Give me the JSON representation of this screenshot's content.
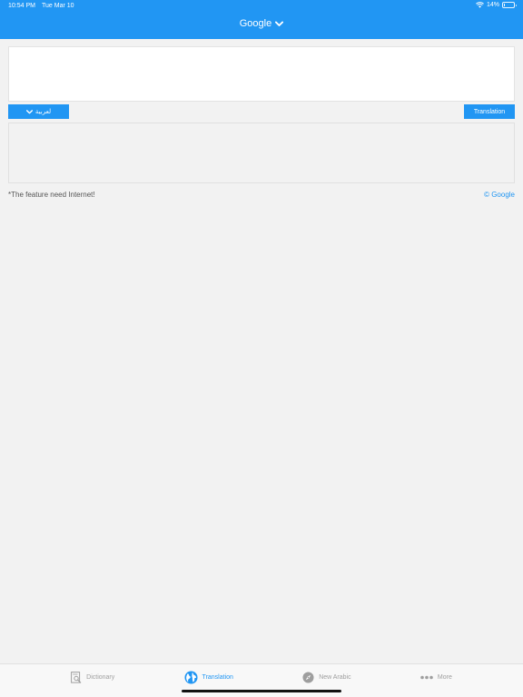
{
  "status_bar": {
    "time": "10:54 PM",
    "date": "Tue Mar 10",
    "battery": "14%",
    "battery_level": 0.14
  },
  "header": {
    "title": "Google"
  },
  "input": {
    "text": ""
  },
  "controls": {
    "language_label": "لعربية",
    "translate_label": "Translation"
  },
  "output": {
    "text": ""
  },
  "notice": "*The feature need Internet!",
  "credit": "© Google",
  "tabs": [
    {
      "label": "Dictionary",
      "icon": "dictionary-icon",
      "active": false
    },
    {
      "label": "Translation",
      "icon": "globe-icon",
      "active": true
    },
    {
      "label": "New Arabic",
      "icon": "compass-icon",
      "active": false
    },
    {
      "label": "More",
      "icon": "more-icon",
      "active": false
    }
  ],
  "colors": {
    "accent": "#2196f3",
    "background": "#f2f2f2",
    "inactive": "#9e9e9e"
  }
}
